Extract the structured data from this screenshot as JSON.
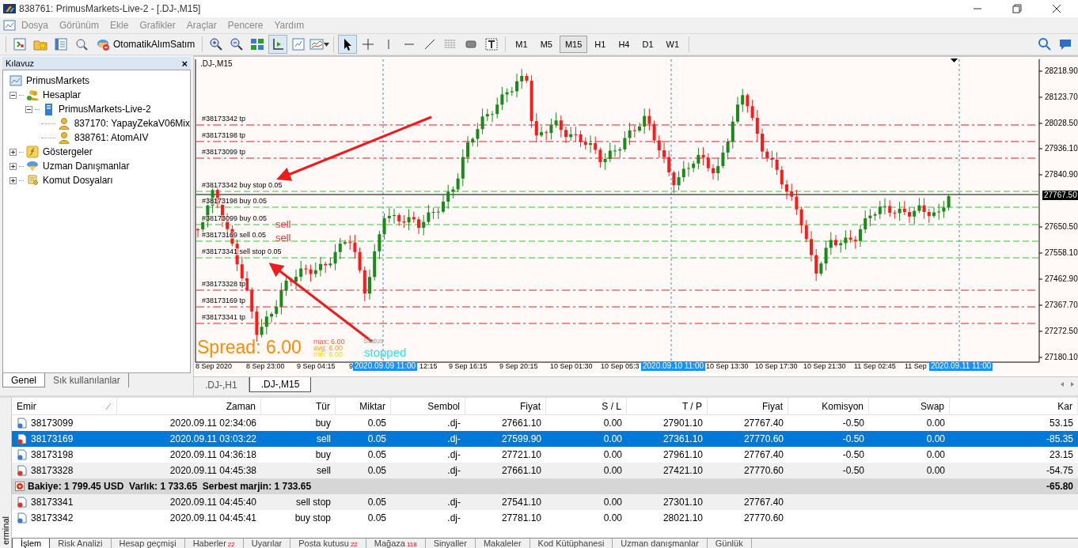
{
  "window": {
    "title": "838761: PrimusMarkets-Live-2 - [.DJ-,M15]"
  },
  "menu": [
    "Dosya",
    "Görünüm",
    "Ekle",
    "Grafikler",
    "Araçlar",
    "Pencere",
    "Yardım"
  ],
  "toolbar": {
    "auto_trading_label": "OtomatikAlımSatım",
    "timeframes": [
      {
        "label": "M1",
        "selected": false
      },
      {
        "label": "M5",
        "selected": false
      },
      {
        "label": "M15",
        "selected": true
      },
      {
        "label": "H1",
        "selected": false
      },
      {
        "label": "H4",
        "selected": false
      },
      {
        "label": "D1",
        "selected": false
      },
      {
        "label": "W1",
        "selected": false
      }
    ]
  },
  "navigator": {
    "title": "Kılavuz",
    "close": "×",
    "tree": [
      {
        "label": "PrimusMarkets",
        "kind": "root",
        "children": [
          {
            "label": "Hesaplar",
            "kind": "accounts",
            "expanded": true,
            "children": [
              {
                "label": "PrimusMarkets-Live-2",
                "kind": "server",
                "expanded": true,
                "children": [
                  {
                    "label": "837170: YapayZekaV06Mix",
                    "kind": "account"
                  },
                  {
                    "label": "838761: AtomAIV",
                    "kind": "account"
                  }
                ]
              }
            ]
          },
          {
            "label": "Göstergeler",
            "kind": "indicators",
            "expanded": false
          },
          {
            "label": "Uzman Danışmanlar",
            "kind": "experts",
            "expanded": false
          },
          {
            "label": "Komut Dosyaları",
            "kind": "scripts",
            "expanded": false
          }
        ]
      }
    ],
    "tabs": [
      {
        "label": "Genel",
        "selected": true
      },
      {
        "label": "Sık kullanılanlar",
        "selected": false
      }
    ]
  },
  "chart": {
    "title": ".DJ-,M15",
    "price_ticks": [
      "28218.90",
      "28123.70",
      "28028.50",
      "27936.10",
      "27840.90",
      "27650.50",
      "27558.10",
      "27462.90",
      "27367.70",
      "27272.50",
      "27180.10"
    ],
    "current_price": "27767.50",
    "time_labels": [
      "8 Sep 2020",
      "8 Sep 23:00",
      "9 Sep 04:15",
      "9",
      "12:15",
      "9 Sep 16:15",
      "9 Sep 20:15",
      "10 Sep 01:30",
      "10 Sep 05:3",
      "10 Sep 13:30",
      "10 Sep 17:30",
      "10 Sep 21:30",
      "11 Sep 02:45",
      "11 Sep"
    ],
    "time_highlights": [
      "2020.09.09 11:00",
      "2020.09.10 11:00",
      "2020.09.11 11:00"
    ],
    "order_lines": [
      {
        "label": "#38173342 tp",
        "kind": "tp"
      },
      {
        "label": "#38173198 tp",
        "kind": "tp"
      },
      {
        "label": "#38173099 tp",
        "kind": "tp"
      },
      {
        "label": "#38173342 buy stop 0.05",
        "kind": "order"
      },
      {
        "label": "#38173198 buy 0.05",
        "kind": "order"
      },
      {
        "label": "#38173099 buy 0.05",
        "kind": "order"
      },
      {
        "label": "#38173169 sell 0.05",
        "kind": "order"
      },
      {
        "label": "#38173341 sell stop 0.05",
        "kind": "order"
      },
      {
        "label": "#38173328 tp",
        "kind": "tp"
      },
      {
        "label": "#38173169 tp",
        "kind": "tp"
      },
      {
        "label": "#38173341 tp",
        "kind": "tp"
      }
    ],
    "annotations": [
      "sell",
      "sell"
    ],
    "spread": {
      "label": "Spread: 6.00",
      "max": "max: 6.00",
      "avg": "avg: 6.00",
      "min": "min: 6.00",
      "status_label": "Status",
      "status": "stopped"
    }
  },
  "chart_tabs": [
    {
      "label": ".DJ-,H1",
      "selected": false
    },
    {
      "label": ".DJ-,M15",
      "selected": true
    }
  ],
  "terminal": {
    "side_label": "erminal",
    "columns": [
      "Emir",
      "Zaman",
      "Tür",
      "Miktar",
      "Sembol",
      "Fiyat",
      "S / L",
      "T / P",
      "Fiyat",
      "Komisyon",
      "Swap",
      "Kar"
    ],
    "rows": [
      {
        "kind": "buy",
        "selected": false,
        "cells": [
          "38173099",
          "2020.09.11 02:34:06",
          "buy",
          "0.05",
          ".dj-",
          "27661.10",
          "0.00",
          "27901.10",
          "27767.40",
          "-0.50",
          "0.00",
          "53.15"
        ]
      },
      {
        "kind": "sell",
        "selected": true,
        "cells": [
          "38173169",
          "2020.09.11 03:03:22",
          "sell",
          "0.05",
          ".dj-",
          "27599.90",
          "0.00",
          "27361.10",
          "27770.60",
          "-0.50",
          "0.00",
          "-85.35"
        ]
      },
      {
        "kind": "buy",
        "selected": false,
        "cells": [
          "38173198",
          "2020.09.11 04:36:18",
          "buy",
          "0.05",
          ".dj-",
          "27721.10",
          "0.00",
          "27961.10",
          "27767.40",
          "-0.50",
          "0.00",
          "23.15"
        ]
      },
      {
        "kind": "sell",
        "selected": false,
        "cells": [
          "38173328",
          "2020.09.11 04:45:38",
          "sell",
          "0.05",
          ".dj-",
          "27661.10",
          "0.00",
          "27421.10",
          "27770.60",
          "-0.50",
          "0.00",
          "-54.75"
        ]
      }
    ],
    "summary": {
      "text": "Bakiye: 1 799.45 USD  Varlık: 1 733.65  Serbest marjin: 1 733.65",
      "profit": "-65.80"
    },
    "pending": [
      {
        "kind": "sell",
        "cells": [
          "38173341",
          "2020.09.11 04:45:40",
          "sell stop",
          "0.05",
          ".dj-",
          "27541.10",
          "0.00",
          "27301.10",
          "27767.40"
        ]
      },
      {
        "kind": "buy",
        "cells": [
          "38173342",
          "2020.09.11 04:45:41",
          "buy stop",
          "0.05",
          ".dj-",
          "27781.10",
          "0.00",
          "28021.10",
          "27770.60"
        ]
      }
    ],
    "tabs": [
      {
        "label": "İşlem",
        "selected": true
      },
      {
        "label": "Risk Analizi",
        "selected": false
      },
      {
        "label": "Hesap geçmişi",
        "selected": false
      },
      {
        "label": "Haberler",
        "selected": false,
        "badge": "22"
      },
      {
        "label": "Uyarılar",
        "selected": false
      },
      {
        "label": "Posta kutusu",
        "selected": false,
        "badge": "22"
      },
      {
        "label": "Mağaza",
        "selected": false,
        "badge": "118"
      },
      {
        "label": "Sinyaller",
        "selected": false
      },
      {
        "label": "Makaleler",
        "selected": false
      },
      {
        "label": "Kod Kütüphanesi",
        "selected": false
      },
      {
        "label": "Uzman danışmanlar",
        "selected": false
      },
      {
        "label": "Günlük",
        "selected": false
      }
    ]
  }
}
